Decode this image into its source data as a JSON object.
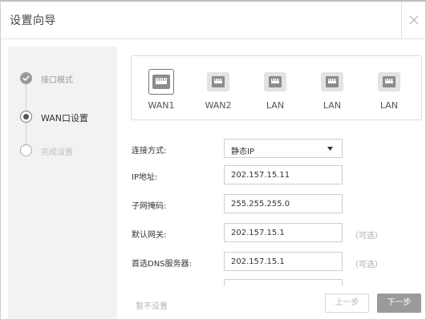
{
  "window": {
    "title": "设置向导",
    "close_icon": "close-icon"
  },
  "steps": [
    {
      "label": "接口模式",
      "state": "done"
    },
    {
      "label": "WAN口设置",
      "state": "current"
    },
    {
      "label": "完成设置",
      "state": "pending"
    }
  ],
  "ports": [
    {
      "label": "WAN1",
      "selected": true
    },
    {
      "label": "WAN2",
      "selected": false
    },
    {
      "label": "LAN",
      "selected": false
    },
    {
      "label": "LAN",
      "selected": false
    },
    {
      "label": "LAN",
      "selected": false
    }
  ],
  "form": {
    "connection_type": {
      "label": "连接方式:",
      "value": "静态IP"
    },
    "ip": {
      "label": "IP地址:",
      "value": "202.157.15.11"
    },
    "subnet": {
      "label": "子网掩码:",
      "value": "255.255.255.0"
    },
    "gateway": {
      "label": "默认网关:",
      "value": "202.157.15.1",
      "optional": "（可选）"
    },
    "dns": {
      "label": "首选DNS服务器:",
      "value": "202.157.15.1",
      "optional": "（可选）"
    }
  },
  "footer": {
    "skip_label": "暂不设置",
    "prev_label": "上一步",
    "next_label": "下一步"
  },
  "colors": {
    "accent_gray": "#9a9a9a",
    "border": "#cfcfcf",
    "sidebar_bg": "#f2f2f2"
  }
}
